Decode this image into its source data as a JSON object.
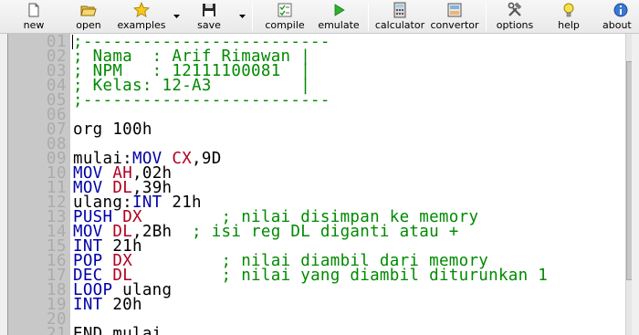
{
  "toolbar": {
    "new_label": "new",
    "open_label": "open",
    "examples_label": "examples",
    "save_label": "save",
    "compile_label": "compile",
    "emulate_label": "emulate",
    "calculator_label": "calculator",
    "convertor_label": "convertor",
    "options_label": "options",
    "help_label": "help",
    "about_label": "about"
  },
  "editor": {
    "line_numbers": [
      "01",
      "02",
      "03",
      "04",
      "05",
      "06",
      "07",
      "08",
      "09",
      "10",
      "11",
      "12",
      "13",
      "14",
      "15",
      "16",
      "17",
      "18",
      "19",
      "20",
      "21"
    ],
    "lines": [
      [
        {
          "t": ";-------------------------",
          "c": "cm"
        }
      ],
      [
        {
          "t": "; Nama  : Arif Rimawan |",
          "c": "cm"
        }
      ],
      [
        {
          "t": "; NPM   : 12111100081  |",
          "c": "cm"
        }
      ],
      [
        {
          "t": "; Kelas: 12-A3         |",
          "c": "cm"
        }
      ],
      [
        {
          "t": ";-------------------------",
          "c": "cm"
        }
      ],
      [],
      [
        {
          "t": "org 100h",
          "c": "text"
        }
      ],
      [],
      [
        {
          "t": "mulai:",
          "c": "text"
        },
        {
          "t": "MOV",
          "c": "kw"
        },
        {
          "t": " ",
          "c": "text"
        },
        {
          "t": "CX",
          "c": "reg"
        },
        {
          "t": ",9D",
          "c": "text"
        }
      ],
      [
        {
          "t": "MOV",
          "c": "kw"
        },
        {
          "t": " ",
          "c": "text"
        },
        {
          "t": "AH",
          "c": "reg"
        },
        {
          "t": ",02h",
          "c": "text"
        }
      ],
      [
        {
          "t": "MOV",
          "c": "kw"
        },
        {
          "t": " ",
          "c": "text"
        },
        {
          "t": "DL",
          "c": "reg"
        },
        {
          "t": ",39h",
          "c": "text"
        }
      ],
      [
        {
          "t": "ulang:",
          "c": "text"
        },
        {
          "t": "INT",
          "c": "kw"
        },
        {
          "t": " 21h",
          "c": "text"
        }
      ],
      [
        {
          "t": "PUSH",
          "c": "kw"
        },
        {
          "t": " ",
          "c": "text"
        },
        {
          "t": "DX",
          "c": "reg"
        },
        {
          "t": "        ; nilai disimpan ke memory",
          "c": "cm"
        }
      ],
      [
        {
          "t": "MOV",
          "c": "kw"
        },
        {
          "t": " ",
          "c": "text"
        },
        {
          "t": "DL",
          "c": "reg"
        },
        {
          "t": ",2Bh  ",
          "c": "text"
        },
        {
          "t": "; isi reg DL diganti atau +",
          "c": "cm"
        }
      ],
      [
        {
          "t": "INT",
          "c": "kw"
        },
        {
          "t": " 21h",
          "c": "text"
        }
      ],
      [
        {
          "t": "POP",
          "c": "kw"
        },
        {
          "t": " ",
          "c": "text"
        },
        {
          "t": "DX",
          "c": "reg"
        },
        {
          "t": "         ; nilai diambil dari memory",
          "c": "cm"
        }
      ],
      [
        {
          "t": "DEC",
          "c": "kw"
        },
        {
          "t": " ",
          "c": "text"
        },
        {
          "t": "DL",
          "c": "reg"
        },
        {
          "t": "         ; nilai yang diambil diturunkan 1",
          "c": "cm"
        }
      ],
      [
        {
          "t": "LOOP",
          "c": "kw"
        },
        {
          "t": " ulang",
          "c": "text"
        }
      ],
      [
        {
          "t": "INT",
          "c": "kw"
        },
        {
          "t": " 20h",
          "c": "text"
        }
      ],
      [],
      [
        {
          "t": "END mulai",
          "c": "text"
        }
      ]
    ]
  },
  "colors": {
    "keyword": "#0000a8",
    "register": "#b00020",
    "comment": "#008a00",
    "gutter_bg": "#c8c8c8",
    "gutter_text": "#ababab"
  },
  "icons": {
    "new": "new-file-icon",
    "open": "open-folder-icon",
    "examples": "star-icon",
    "save": "floppy-disk-icon",
    "compile": "checklist-icon",
    "emulate": "play-icon",
    "calculator": "calculator-icon",
    "convertor": "convertor-icon",
    "options": "tools-icon",
    "help": "lightbulb-icon",
    "about": "info-icon"
  }
}
